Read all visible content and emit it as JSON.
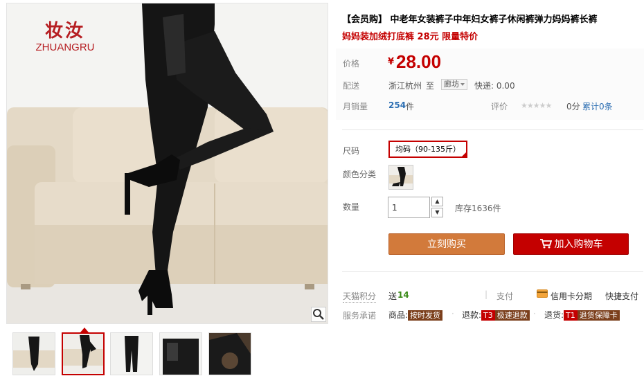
{
  "brand": {
    "name_cn": "妆汝",
    "name_en": "ZHUANGRU"
  },
  "product": {
    "title_line1": "【会员购】 中老年女装裤子中年妇女裤子休闲裤弹力妈妈裤长裤",
    "title_line2": "妈妈装加绒打底裤 28元 限量特价"
  },
  "price": {
    "label": "价格",
    "currency": "¥",
    "value": "28.00"
  },
  "shipping": {
    "label": "配送",
    "from": "浙江杭州",
    "to_word": "至",
    "destination": "廊坊",
    "express": "快递: 0.00"
  },
  "sales": {
    "label": "月销量",
    "count": "254",
    "unit": "件"
  },
  "rating": {
    "label": "评价",
    "stars": "★★★★★",
    "score": "0分",
    "total": "累计0条"
  },
  "size": {
    "label": "尺码",
    "option": "均码（90-135斤）"
  },
  "color": {
    "label": "颜色分类"
  },
  "quantity": {
    "label": "数量",
    "value": "1",
    "stock": "库存1636件"
  },
  "buttons": {
    "buy_now": "立刻购买",
    "add_cart": "加入购物车"
  },
  "points": {
    "label": "天猫积分",
    "prefix": "送",
    "value": "14"
  },
  "pay": {
    "label": "支付",
    "credit": "信用卡分期",
    "quick": "快捷支付"
  },
  "service": {
    "label": "服务承诺",
    "goods_label": "商品:",
    "goods_badge": "按时发货",
    "refund_label": "退款:",
    "refund_code": "T3",
    "refund_badge": "极速退款",
    "return_label": "退货:",
    "return_code": "T1",
    "return_badge": "退货保障卡"
  },
  "colors": {
    "accent": "#c40000",
    "buy": "#d27a3b",
    "brand": "#b61e22"
  }
}
